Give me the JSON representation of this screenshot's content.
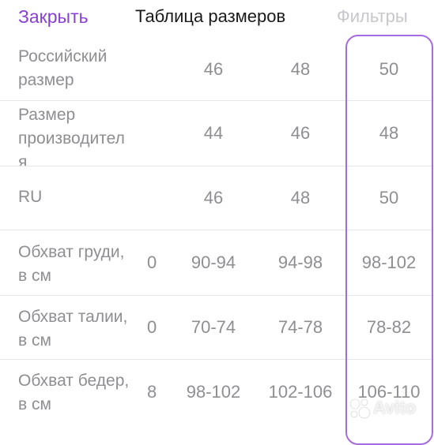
{
  "header": {
    "close_label": "Закрыть",
    "title": "Таблица размеров",
    "filters_label": "Фильтры"
  },
  "rows": [
    {
      "label_line1": "Российский",
      "label_line2": "размер",
      "c0": "",
      "c1": "46",
      "c2": "48",
      "c3": "50"
    },
    {
      "label_line1": "Размер",
      "label_line2": "производител",
      "label_line3": "я",
      "c0": "",
      "c1": "44",
      "c2": "46",
      "c3": "48"
    },
    {
      "label_line1": "RU",
      "label_line2": "",
      "c0": "",
      "c1": "46",
      "c2": "48",
      "c3": "50"
    },
    {
      "label_line1": "Обхват груди,",
      "label_line2": "в см",
      "c0": "0",
      "c1": "90-94",
      "c2": "94-98",
      "c3": "98-102"
    },
    {
      "label_line1": "Обхват талии,",
      "label_line2": "в см",
      "c0": "0",
      "c1": "70-74",
      "c2": "74-78",
      "c3": "78-82"
    },
    {
      "label_line1": "Обхват бедер,",
      "label_line2": "в см",
      "c0": "8",
      "c1": "98-102",
      "c2": "102-106",
      "c3": "106-110"
    }
  ],
  "watermark": {
    "text": "Avito"
  },
  "colors": {
    "accent": "#8a3fd6",
    "highlight_border": "#a66be0",
    "text_gray": "#8e8e93",
    "filters_gray": "#c7c7cc"
  }
}
